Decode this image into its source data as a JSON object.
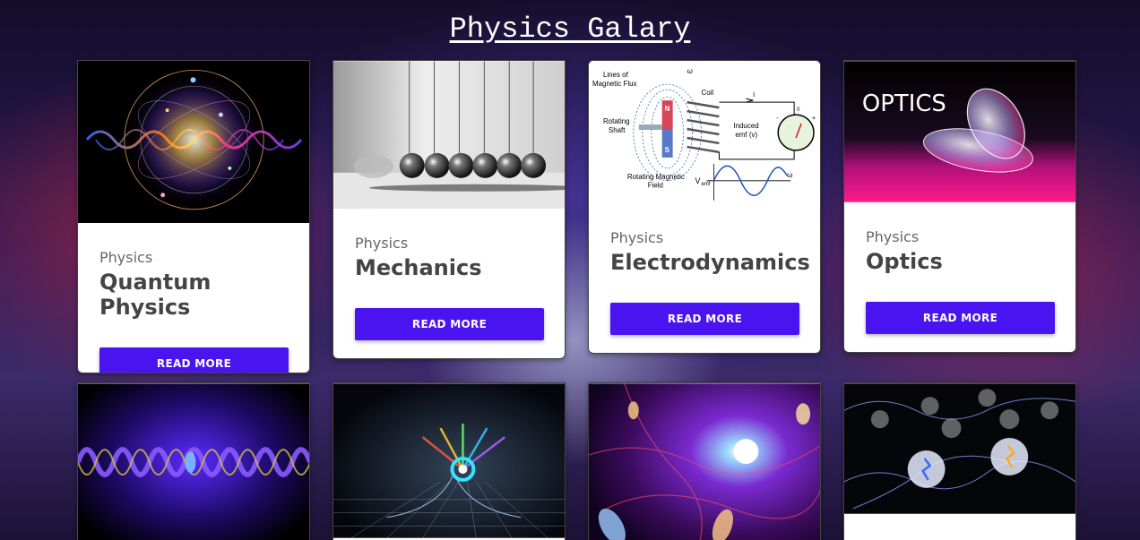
{
  "page": {
    "title": "Physics Galary"
  },
  "cards": [
    {
      "category": "Physics",
      "title": "Quantum Physics",
      "button": "READ MORE",
      "image": "quantum-atom-image"
    },
    {
      "category": "Physics",
      "title": "Mechanics",
      "button": "READ MORE",
      "image": "newtons-cradle-image"
    },
    {
      "category": "Physics",
      "title": "Electrodynamics",
      "button": "READ MORE",
      "image": "generator-diagram-image"
    },
    {
      "category": "Physics",
      "title": "Optics",
      "button": "READ MORE",
      "image": "optics-lenses-image"
    },
    {
      "image": "light-wave-image"
    },
    {
      "image": "wormhole-image"
    },
    {
      "image": "galaxy-cosmos-image"
    },
    {
      "image": "qubits-image"
    }
  ],
  "diagram_labels": {
    "flux": [
      "Lines of",
      "Magnetic Flux"
    ],
    "omega": "ω",
    "coil": "Coil",
    "current": "i",
    "north": "N",
    "south": "S",
    "shaft": [
      "Rotating",
      "Shaft"
    ],
    "emf": [
      "Induced",
      "emf (v)"
    ],
    "field": [
      "Rotating Magnetic",
      "Field"
    ],
    "vemf": "V",
    "vemf_sub": "emf",
    "meter_zero": "0",
    "meter_minus": "-",
    "meter_plus": "+"
  },
  "optics_banner": "OPTICS",
  "colors": {
    "accent": "#4a14f0",
    "card_bg": "#ffffff"
  }
}
